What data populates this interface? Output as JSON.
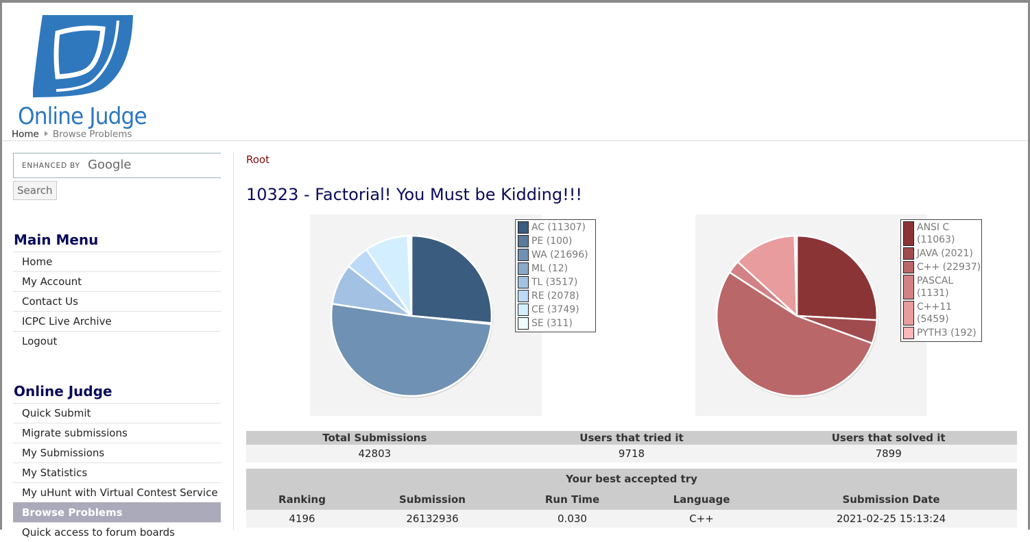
{
  "header": {
    "logo_text": "Online Judge",
    "breadcrumb": {
      "home": "Home",
      "current": "Browse Problems"
    }
  },
  "sidebar": {
    "search": {
      "enhanced_label": "ENHANCED BY",
      "google_label": "Google",
      "placeholder": "",
      "button_label": "Search"
    },
    "main_menu": {
      "heading": "Main Menu",
      "items": [
        {
          "label": "Home"
        },
        {
          "label": "My Account"
        },
        {
          "label": "Contact Us"
        },
        {
          "label": "ICPC Live Archive"
        },
        {
          "label": "Logout"
        }
      ]
    },
    "online_judge": {
      "heading": "Online Judge",
      "items": [
        {
          "label": "Quick Submit"
        },
        {
          "label": "Migrate submissions"
        },
        {
          "label": "My Submissions"
        },
        {
          "label": "My Statistics"
        },
        {
          "label": "My uHunt with Virtual Contest Service"
        },
        {
          "label": "Browse Problems",
          "active": true
        },
        {
          "label": "Quick access to forum boards"
        }
      ]
    }
  },
  "main": {
    "root_link": "Root",
    "problem_title": "10323 - Factorial! You Must be Kidding!!!",
    "stats": {
      "headers": [
        "Total Submissions",
        "Users that tried it",
        "Users that solved it"
      ],
      "values": [
        "42803",
        "9718",
        "7899"
      ]
    },
    "best_try": {
      "caption": "Your best accepted try",
      "headers": [
        "Ranking",
        "Submission",
        "Run Time",
        "Language",
        "Submission Date"
      ],
      "values": [
        "4196",
        "26132936",
        "0.030",
        "C++",
        "2021-02-25 15:13:24"
      ]
    }
  },
  "chart_data": [
    {
      "type": "pie",
      "legend_position": "right",
      "slices": [
        {
          "label": "AC (11307)",
          "value": 11307,
          "color": "#3a5c7e"
        },
        {
          "label": "PE (100)",
          "value": 100,
          "color": "#5a7b9a"
        },
        {
          "label": "WA (21696)",
          "value": 21696,
          "color": "#6f91b3"
        },
        {
          "label": "ML (12)",
          "value": 12,
          "color": "#8aa8c8"
        },
        {
          "label": "TL (3517)",
          "value": 3517,
          "color": "#a3c2e3"
        },
        {
          "label": "RE (2078)",
          "value": 2078,
          "color": "#bcdaf8"
        },
        {
          "label": "CE (3749)",
          "value": 3749,
          "color": "#d3efff"
        },
        {
          "label": "SE (311)",
          "value": 311,
          "color": "#eefbff"
        }
      ]
    },
    {
      "type": "pie",
      "legend_position": "right",
      "slices": [
        {
          "label": "ANSI C (11063)",
          "value": 11063,
          "color": "#8b3436"
        },
        {
          "label": "JAVA (2021)",
          "value": 2021,
          "color": "#a04b4d"
        },
        {
          "label": "C++ (22937)",
          "value": 22937,
          "color": "#b96769"
        },
        {
          "label": "PASCAL (1131)",
          "value": 1131,
          "color": "#d28284"
        },
        {
          "label": "C++11 (5459)",
          "value": 5459,
          "color": "#e89c9d"
        },
        {
          "label": "PYTH3 (192)",
          "value": 192,
          "color": "#fbb8b9"
        }
      ]
    }
  ]
}
